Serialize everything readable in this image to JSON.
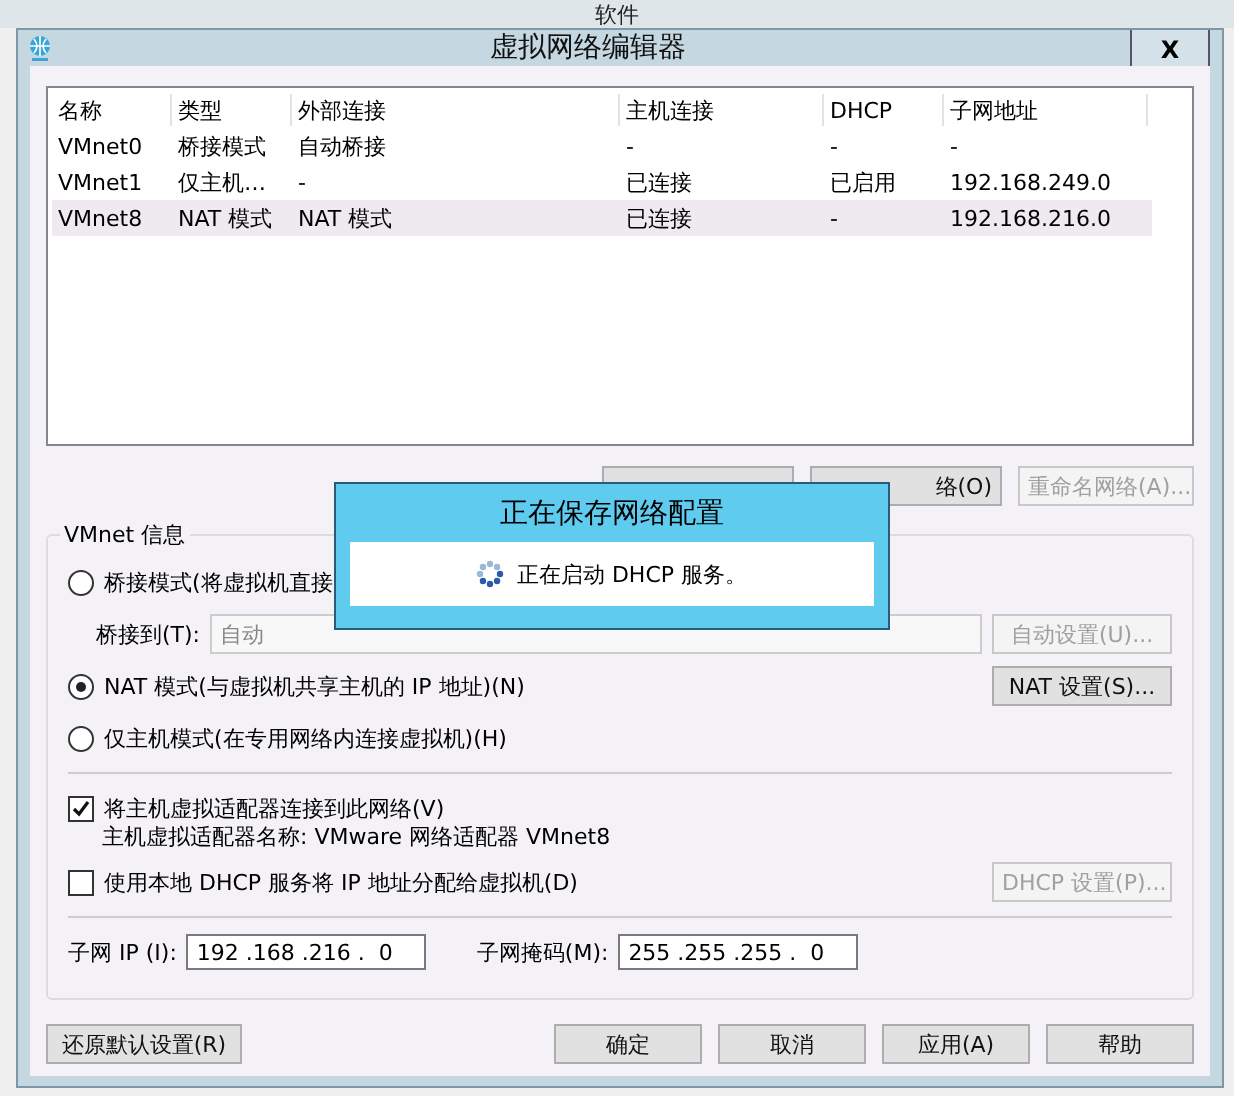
{
  "background_window": {
    "title": "软件"
  },
  "window": {
    "title": "虚拟网络编辑器",
    "close": "X"
  },
  "table": {
    "columns": [
      "名称",
      "类型",
      "外部连接",
      "主机连接",
      "DHCP",
      "子网地址"
    ],
    "rows": [
      {
        "cells": [
          "VMnet0",
          "桥接模式",
          "自动桥接",
          "-",
          "-",
          "-"
        ],
        "selected": false
      },
      {
        "cells": [
          "VMnet1",
          "仅主机…",
          "-",
          "已连接",
          "已启用",
          "192.168.249.0"
        ],
        "selected": false
      },
      {
        "cells": [
          "VMnet8",
          "NAT 模式",
          "NAT 模式",
          "已连接",
          "-",
          "192.168.216.0"
        ],
        "selected": true
      }
    ]
  },
  "network_buttons": [
    {
      "disabled": false
    },
    {
      "label": "络(O)",
      "disabled": false
    },
    {
      "label": "重命名网络(A)...",
      "disabled": true
    }
  ],
  "vmnet_info": {
    "title": "VMnet 信息",
    "modes": [
      {
        "label": "桥接模式(将虚拟机直接",
        "selected": false
      },
      {
        "label": "NAT 模式(与虚拟机共享主机的 IP 地址)(N)",
        "selected": true
      },
      {
        "label": "仅主机模式(在专用网络内连接虚拟机)(H)",
        "selected": false
      }
    ],
    "bridge_to": {
      "label": "桥接到(T):",
      "value": "自动",
      "disabled": true,
      "button": "自动设置(U)..."
    },
    "nat_button": "NAT 设置(S)...",
    "connect_adapter": {
      "label": "将主机虚拟适配器连接到此网络(V)",
      "checked": true
    },
    "adapter_name": "主机虚拟适配器名称: VMware 网络适配器 VMnet8",
    "local_dhcp": {
      "label": "使用本地 DHCP 服务将 IP 地址分配给虚拟机(D)",
      "checked": false,
      "button": "DHCP 设置(P)...",
      "button_disabled": true
    },
    "subnet_ip": {
      "label": "子网 IP (I):",
      "value": "192 .168 .216 .  0"
    },
    "subnet_mask": {
      "label": "子网掩码(M):",
      "value": "255 .255 .255 .  0"
    }
  },
  "bottom_buttons": {
    "restore": "还原默认设置(R)",
    "actions": [
      "确定",
      "取消",
      "应用(A)",
      "帮助"
    ]
  },
  "progress_dialog": {
    "title": "正在保存网络配置",
    "message": "正在启动 DHCP 服务。"
  }
}
